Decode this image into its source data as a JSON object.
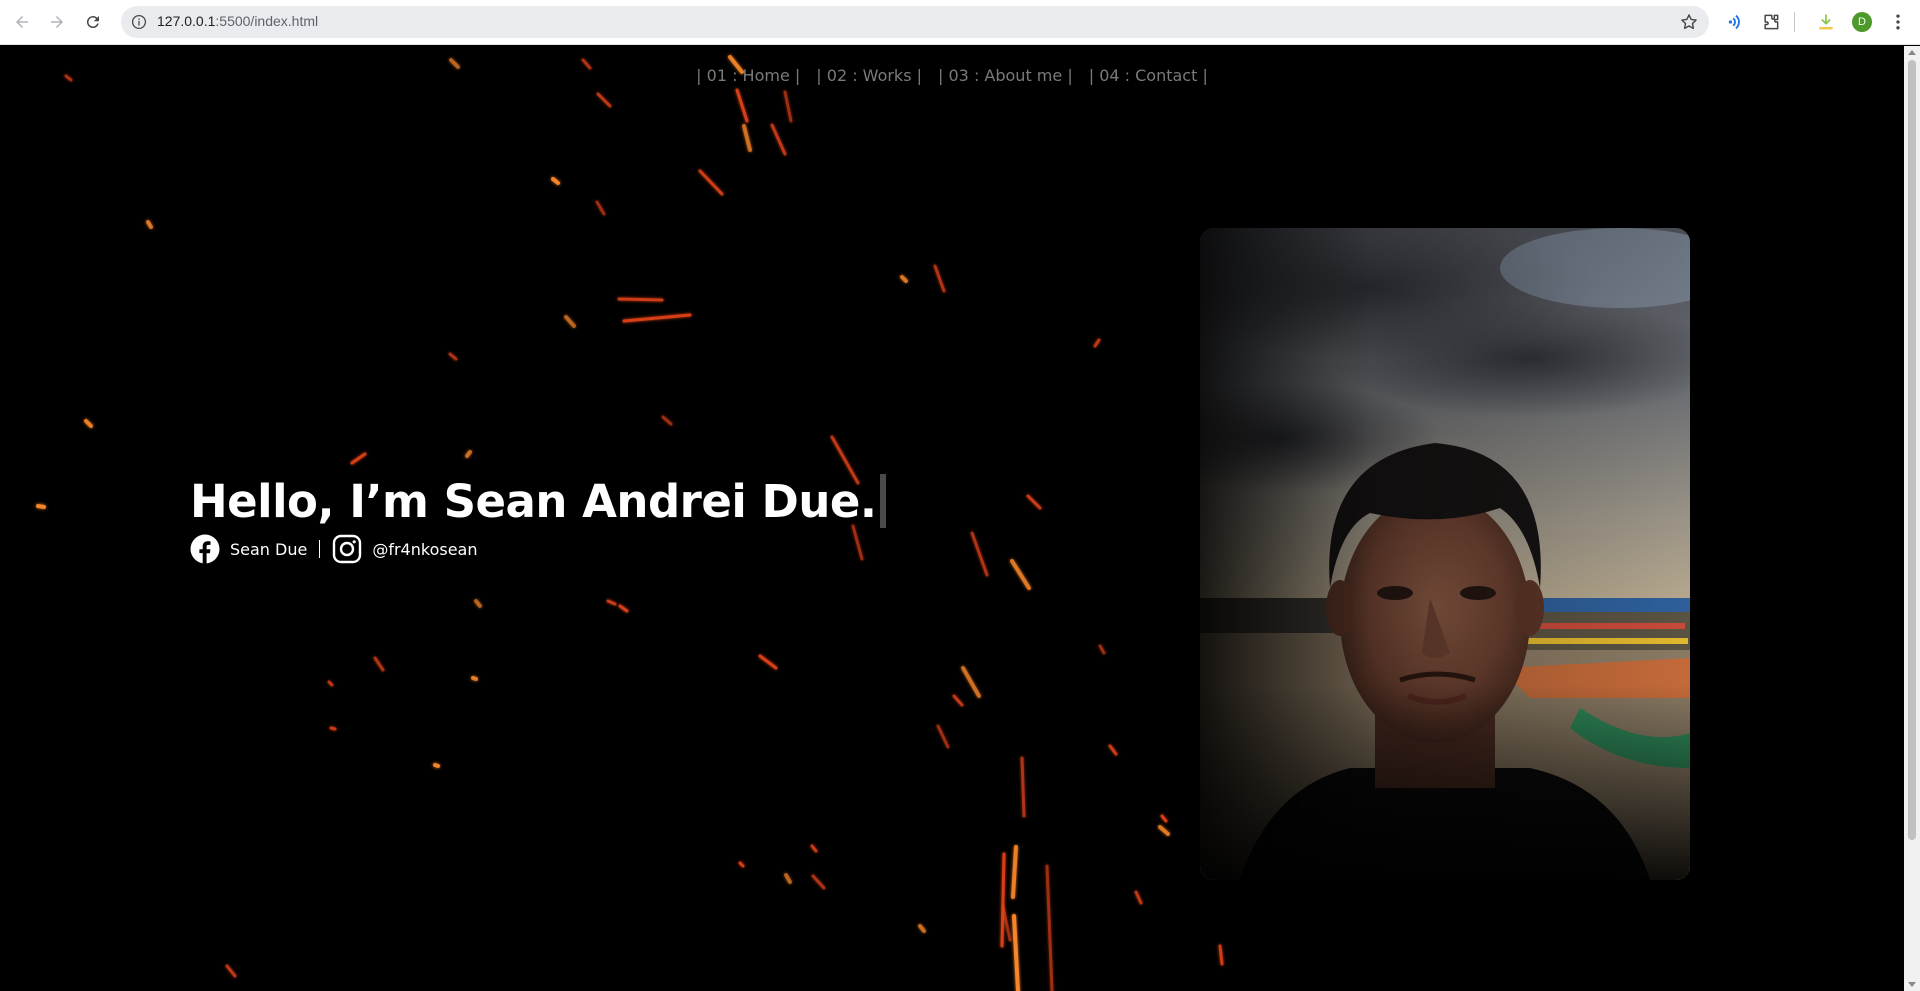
{
  "browser": {
    "url_host": "127.0.0.1",
    "url_rest": ":5500/index.html",
    "profile_initial": "D",
    "icons": {
      "back": "back-arrow-icon",
      "forward": "forward-arrow-icon",
      "reload": "reload-icon",
      "info": "site-info-icon",
      "star": "bookmark-star-icon",
      "media": "media-cast-icon",
      "extensions": "extensions-puzzle-icon",
      "downloads": "download-icon",
      "menu": "kebab-menu-icon"
    }
  },
  "nav": {
    "items": [
      {
        "label": "| 01 : Home |"
      },
      {
        "label": "| 02 : Works |"
      },
      {
        "label": "| 03 : About me |"
      },
      {
        "label": "| 04 : Contact |"
      }
    ]
  },
  "hero": {
    "title": "Hello, I’m Sean Andrei Due."
  },
  "socials": {
    "facebook": {
      "icon": "facebook-icon",
      "label": "Sean Due"
    },
    "instagram": {
      "icon": "instagram-icon",
      "label": "@fr4nkosean"
    }
  },
  "photo": {
    "subject": "portrait-photo"
  },
  "colors": {
    "background": "#000000",
    "spark": "#ff5a14",
    "text": "#ffffff",
    "nav_text": "#7a7a7a"
  }
}
